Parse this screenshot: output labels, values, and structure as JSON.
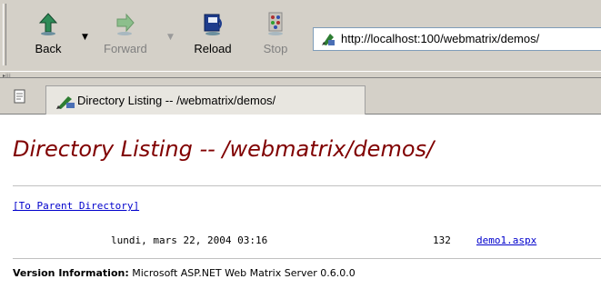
{
  "toolbar": {
    "back_label": "Back",
    "forward_label": "Forward",
    "reload_label": "Reload",
    "stop_label": "Stop",
    "colors": {
      "back": "#2e8b57",
      "forward": "#8cbf8c",
      "reload": "#1e3c8c",
      "stop": "#b03030"
    }
  },
  "address": {
    "url": "http://localhost:100/webmatrix/demos/",
    "icon": "page-icon"
  },
  "tab": {
    "title": "Directory Listing -- /webmatrix/demos/",
    "icon": "folder-pencil-icon"
  },
  "page": {
    "title": "Directory Listing -- /webmatrix/demos/",
    "title_color": "#800000",
    "parent_link": "[To Parent Directory]",
    "entries": [
      {
        "date": "lundi, mars 22, 2004 03:16",
        "size": "132",
        "name": "demo1.aspx"
      }
    ],
    "version_label": "Version Information:",
    "version_text": " Microsoft ASP.NET Web Matrix Server 0.6.0.0"
  }
}
